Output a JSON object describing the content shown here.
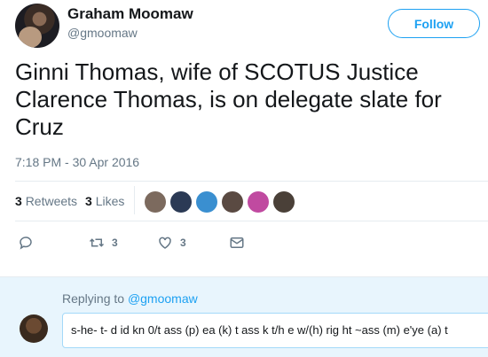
{
  "author": {
    "name": "Graham Moomaw",
    "handle": "@gmoomaw"
  },
  "follow_label": "Follow",
  "tweet": {
    "text": "Ginni Thomas, wife of SCOTUS Justice Clarence Thomas, is on delegate slate for Cruz",
    "timestamp": "7:18 PM - 30 Apr 2016"
  },
  "stats": {
    "retweets_count": "3",
    "retweets_label": "Retweets",
    "likes_count": "3",
    "likes_label": "Likes"
  },
  "liker_colors": [
    "#7c6a5e",
    "#2b3a55",
    "#3a8fd0",
    "#5a4a42",
    "#c04aa0",
    "#4a4038"
  ],
  "actions": {
    "reply_icon": "reply-icon",
    "retweet_icon": "retweet-icon",
    "retweet_count": "3",
    "like_icon": "heart-icon",
    "like_count": "3",
    "dm_icon": "envelope-icon"
  },
  "reply": {
    "replying_prefix": "Replying to ",
    "replying_handle": "@gmoomaw",
    "draft_text": "s-he- t-  d id kn 0/t ass (p) ea (k) t ass k t/h e w/(h) rig ht ~ass (m) e'ye (a) t"
  },
  "colors": {
    "accent": "#1da1f2",
    "muted": "#657786",
    "reply_bg": "#e8f5fd"
  }
}
